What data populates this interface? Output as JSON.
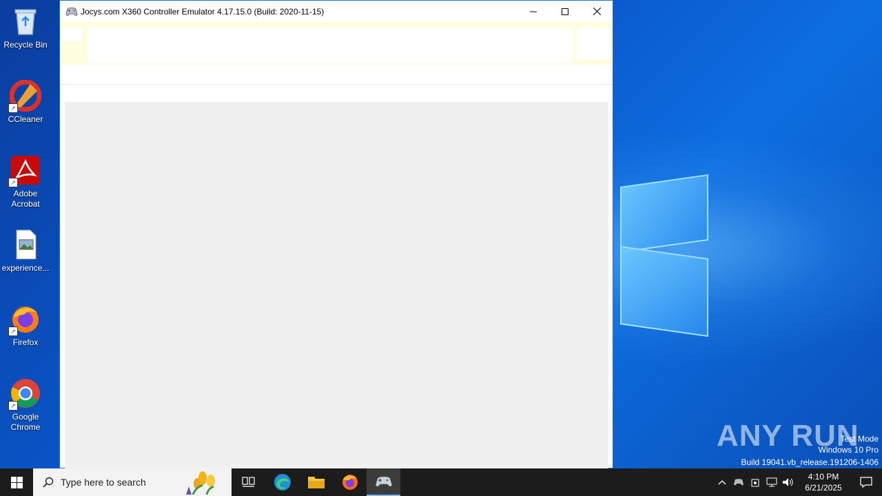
{
  "desktop": {
    "icons": [
      {
        "label": "Recycle Bin",
        "icon": "recycle-bin-icon"
      },
      {
        "label": "CCleaner",
        "icon": "ccleaner-icon"
      },
      {
        "label": "Adobe Acrobat",
        "icon": "adobe-acrobat-icon"
      },
      {
        "label": "experience...",
        "icon": "image-file-icon"
      },
      {
        "label": "Firefox",
        "icon": "firefox-icon"
      },
      {
        "label": "Google Chrome",
        "icon": "chrome-icon"
      }
    ]
  },
  "window": {
    "title": "Jocys.com X360 Controller Emulator 4.17.15.0 (Build: 2020-11-15)",
    "icon": "gamepad-icon"
  },
  "watermark": {
    "brand": "ANY RUN",
    "line1": "Test Mode",
    "line2": "Windows 10 Pro",
    "line3": "Build 19041.vb_release.191206-1406"
  },
  "taskbar": {
    "search_placeholder": "Type here to search",
    "time": "4:10 PM",
    "date": "6/21/2025",
    "pinned": [
      "task-view-icon",
      "edge-icon",
      "file-explorer-icon",
      "firefox-icon",
      "x360ce-icon"
    ]
  },
  "colors": {
    "desktop_blue": "#0a55c8",
    "taskbar": "#1c1c1c",
    "ribbon_yellow": "#fffde0",
    "content_gray": "#f0f0f0"
  }
}
